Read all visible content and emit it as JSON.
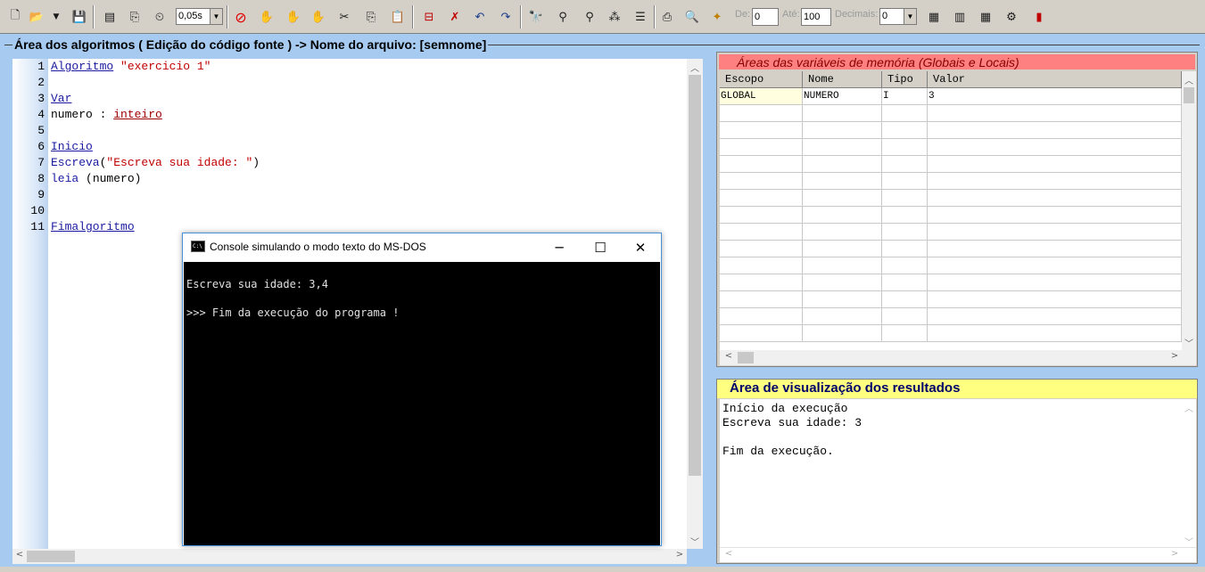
{
  "toolbar": {
    "speed_value": "0,05s",
    "de_label": "De:",
    "de_value": "0",
    "ate_label": "Até:",
    "ate_value": "100",
    "decimais_label": "Decimais:",
    "decimais_value": "0",
    "icons": [
      "new-file",
      "open-folder",
      "save",
      "compile",
      "step",
      "timer",
      "stop",
      "hand",
      "breakpoint",
      "run-step",
      "cut",
      "copy",
      "paste",
      "clear",
      "delete",
      "undo",
      "redo",
      "find",
      "replace",
      "replace-all",
      "format",
      "indent",
      "print",
      "preview",
      "magic",
      "calculator",
      "calc",
      "calendar",
      "help-cd",
      "exit"
    ]
  },
  "editor": {
    "title": "Área dos algoritmos ( Edição do código fonte ) -> Nome do arquivo: [semnome]",
    "lines": [
      {
        "n": "1",
        "parts": [
          {
            "t": "Algoritmo",
            "c": "kw"
          },
          {
            "t": " ",
            "c": ""
          },
          {
            "t": "\"exercicio 1\"",
            "c": "str"
          }
        ]
      },
      {
        "n": "2",
        "parts": []
      },
      {
        "n": "3",
        "parts": [
          {
            "t": "Var",
            "c": "kw"
          }
        ]
      },
      {
        "n": "4",
        "parts": [
          {
            "t": "numero : ",
            "c": ""
          },
          {
            "t": "inteiro",
            "c": "typ"
          }
        ]
      },
      {
        "n": "5",
        "parts": []
      },
      {
        "n": "6",
        "parts": [
          {
            "t": "Inicio",
            "c": "kw"
          }
        ]
      },
      {
        "n": "7",
        "parts": [
          {
            "t": "Escreva",
            "c": "fn"
          },
          {
            "t": "(",
            "c": ""
          },
          {
            "t": "\"Escreva sua idade: \"",
            "c": "str"
          },
          {
            "t": ")",
            "c": ""
          }
        ]
      },
      {
        "n": "8",
        "parts": [
          {
            "t": "leia",
            "c": "fn"
          },
          {
            "t": " (numero)",
            "c": ""
          }
        ]
      },
      {
        "n": "9",
        "parts": []
      },
      {
        "n": "10",
        "parts": []
      },
      {
        "n": "11",
        "parts": [
          {
            "t": "Fimalgoritmo",
            "c": "kw"
          }
        ]
      }
    ]
  },
  "console": {
    "title": "Console simulando o modo texto do MS-DOS",
    "icon_text": "C:\\",
    "minimize": "─",
    "maximize": "☐",
    "close": "✕",
    "output": [
      "Escreva sua idade: 3,4",
      "",
      ">>> Fim da execução do programa !"
    ]
  },
  "memory": {
    "title": "Áreas das variáveis de memória (Globais e Locais)",
    "columns": [
      "Escopo",
      "Nome",
      "Tipo",
      "Valor"
    ],
    "rows": [
      [
        "GLOBAL",
        "NUMERO",
        "I",
        "3"
      ]
    ],
    "empty_rows": 14
  },
  "results": {
    "title": "Área de visualização dos resultados",
    "lines": [
      "Início da execução",
      "Escreva sua idade: 3",
      "",
      "Fim da execução."
    ]
  },
  "colors": {
    "background": "#a6caf0",
    "memory_header": "#ff8080",
    "results_header": "#ffff80",
    "keyword": "#1a1aa0",
    "string": "#c00000"
  }
}
